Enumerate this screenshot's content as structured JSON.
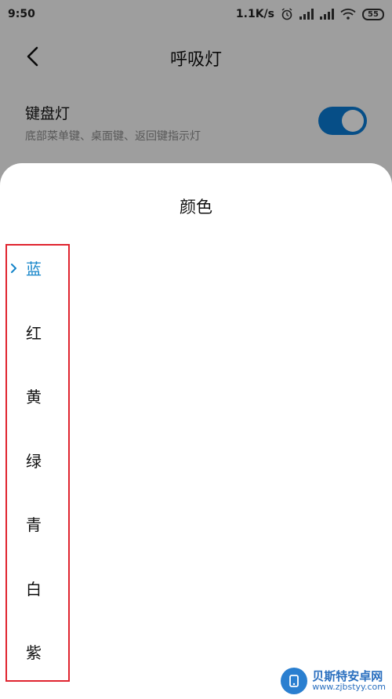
{
  "status_bar": {
    "time": "9:50",
    "network_speed": "1.1K/s",
    "battery_level": "55",
    "icons": [
      "alarm-icon",
      "signal-icon",
      "hd-signal-icon",
      "wifi-icon",
      "battery-icon"
    ]
  },
  "header": {
    "title": "呼吸灯",
    "back_icon": "back-arrow-icon"
  },
  "settings": {
    "keyboard_light": {
      "title": "键盘灯",
      "subtitle": "底部菜单键、桌面键、返回键指示灯",
      "enabled": true
    }
  },
  "sheet": {
    "title": "颜色",
    "options": [
      {
        "label": "蓝",
        "selected": true
      },
      {
        "label": "红",
        "selected": false
      },
      {
        "label": "黄",
        "selected": false
      },
      {
        "label": "绿",
        "selected": false
      },
      {
        "label": "青",
        "selected": false
      },
      {
        "label": "白",
        "selected": false
      },
      {
        "label": "紫",
        "selected": false
      }
    ]
  },
  "watermark": {
    "name": "贝斯特安卓网",
    "url": "www.zjbstyy.com"
  },
  "colors": {
    "accent": "#1585c9",
    "toggle_on": "#0a7ad4",
    "highlight_border": "#e0242f"
  }
}
